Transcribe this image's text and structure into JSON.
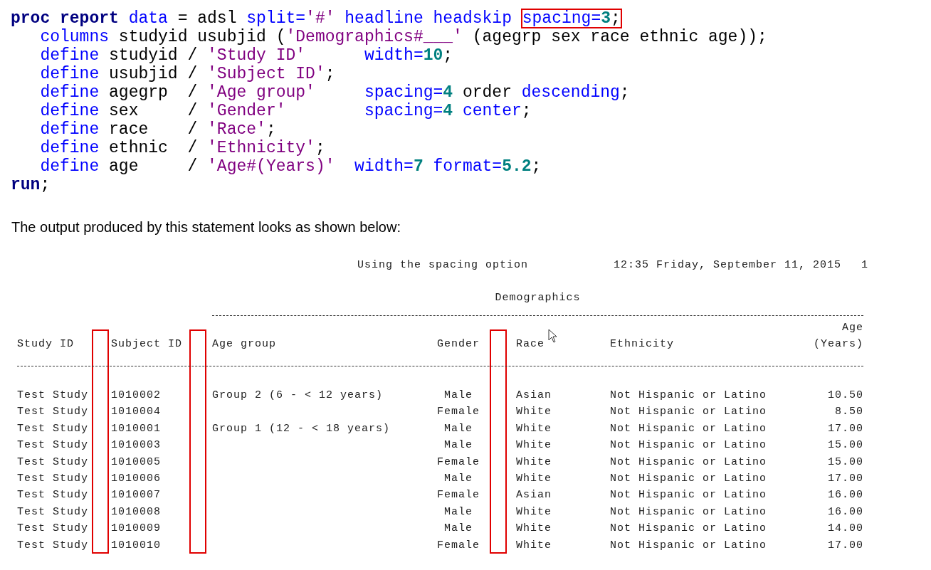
{
  "code": {
    "statements": [
      {
        "tokens": [
          {
            "text": "proc report",
            "kind": "keyword"
          },
          {
            "text": " data",
            "kind": "option"
          },
          {
            "text": " = adsl ",
            "kind": "plain"
          },
          {
            "text": "split=",
            "kind": "option"
          },
          {
            "text": "'#'",
            "kind": "string"
          },
          {
            "text": " headline headskip ",
            "kind": "option"
          },
          {
            "kind": "boxed",
            "tokens": [
              {
                "text": "spacing=",
                "kind": "option"
              },
              {
                "text": "3",
                "kind": "number"
              },
              {
                "text": ";",
                "kind": "plain"
              }
            ]
          }
        ],
        "children": [
          {
            "tokens": [
              {
                "text": "columns",
                "kind": "option"
              },
              {
                "text": " studyid usubjid (",
                "kind": "plain"
              },
              {
                "text": "'Demographics#___'",
                "kind": "string"
              },
              {
                "text": " (agegrp sex race ethnic age));",
                "kind": "plain"
              }
            ]
          },
          {
            "tokens": [
              {
                "text": "define",
                "kind": "option"
              },
              {
                "text": " studyid / ",
                "kind": "plain"
              },
              {
                "text": "'Study ID'",
                "kind": "string"
              },
              {
                "text": "      width=",
                "kind": "option"
              },
              {
                "text": "10",
                "kind": "number"
              },
              {
                "text": ";",
                "kind": "plain"
              }
            ]
          },
          {
            "tokens": [
              {
                "text": "define",
                "kind": "option"
              },
              {
                "text": " usubjid / ",
                "kind": "plain"
              },
              {
                "text": "'Subject ID'",
                "kind": "string"
              },
              {
                "text": ";",
                "kind": "plain"
              }
            ]
          },
          {
            "tokens": [
              {
                "text": "define",
                "kind": "option"
              },
              {
                "text": " agegrp  / ",
                "kind": "plain"
              },
              {
                "text": "'Age group'",
                "kind": "string"
              },
              {
                "text": "     spacing=",
                "kind": "option"
              },
              {
                "text": "4",
                "kind": "number"
              },
              {
                "text": " order ",
                "kind": "plain"
              },
              {
                "text": "descending",
                "kind": "option"
              },
              {
                "text": ";",
                "kind": "plain"
              }
            ]
          },
          {
            "tokens": [
              {
                "text": "define",
                "kind": "option"
              },
              {
                "text": " sex     / ",
                "kind": "plain"
              },
              {
                "text": "'Gender'",
                "kind": "string"
              },
              {
                "text": "        spacing=",
                "kind": "option"
              },
              {
                "text": "4",
                "kind": "number"
              },
              {
                "text": " center",
                "kind": "option"
              },
              {
                "text": ";",
                "kind": "plain"
              }
            ]
          },
          {
            "tokens": [
              {
                "text": "define",
                "kind": "option"
              },
              {
                "text": " race    / ",
                "kind": "plain"
              },
              {
                "text": "'Race'",
                "kind": "string"
              },
              {
                "text": ";",
                "kind": "plain"
              }
            ]
          },
          {
            "tokens": [
              {
                "text": "define",
                "kind": "option"
              },
              {
                "text": " ethnic  / ",
                "kind": "plain"
              },
              {
                "text": "'Ethnicity'",
                "kind": "string"
              },
              {
                "text": ";",
                "kind": "plain"
              }
            ]
          },
          {
            "tokens": [
              {
                "text": "define",
                "kind": "option"
              },
              {
                "text": " age     / ",
                "kind": "plain"
              },
              {
                "text": "'Age#(Years)'",
                "kind": "string"
              },
              {
                "text": "  width=",
                "kind": "option"
              },
              {
                "text": "7",
                "kind": "number"
              },
              {
                "text": " format=",
                "kind": "option"
              },
              {
                "text": "5.2",
                "kind": "number"
              },
              {
                "text": ";",
                "kind": "plain"
              }
            ]
          }
        ]
      },
      {
        "tokens": [
          {
            "text": "run",
            "kind": "keyword"
          },
          {
            "text": ";",
            "kind": "plain"
          }
        ]
      }
    ]
  },
  "paragraph": "The output produced by this statement looks as shown below:",
  "report": {
    "title": "Using the spacing option",
    "timestamp": "12:35 Friday, September 11, 2015",
    "page": "1",
    "spanning_header": "Demographics",
    "columns": [
      {
        "header": [
          "Study ID"
        ],
        "gap_highlighted": false
      },
      {
        "header": [
          "Subject ID"
        ],
        "gap_highlighted": true
      },
      {
        "header": [
          "Age group"
        ],
        "gap_highlighted": true
      },
      {
        "header": [
          "Gender"
        ],
        "gap_highlighted": false
      },
      {
        "header": [
          "Race"
        ],
        "gap_highlighted": true
      },
      {
        "header": [
          "Ethnicity"
        ],
        "gap_highlighted": false
      },
      {
        "header": [
          "Age",
          "(Years)"
        ],
        "gap_highlighted": false
      }
    ],
    "rows": [
      {
        "study_id": "Test Study",
        "subject_id": "1010002",
        "age_group": "Group 2 (6 - < 12 years)",
        "gender": "Male",
        "race": "Asian",
        "ethnicity": "Not Hispanic or Latino",
        "age": "10.50"
      },
      {
        "study_id": "Test Study",
        "subject_id": "1010004",
        "gender": "Female",
        "race": "White",
        "ethnicity": "Not Hispanic or Latino",
        "age": "8.50"
      },
      {
        "study_id": "Test Study",
        "subject_id": "1010001",
        "age_group": "Group 1 (12 - < 18 years)",
        "gender": "Male",
        "race": "White",
        "ethnicity": "Not Hispanic or Latino",
        "age": "17.00"
      },
      {
        "study_id": "Test Study",
        "subject_id": "1010003",
        "gender": "Male",
        "race": "White",
        "ethnicity": "Not Hispanic or Latino",
        "age": "15.00"
      },
      {
        "study_id": "Test Study",
        "subject_id": "1010005",
        "gender": "Female",
        "race": "White",
        "ethnicity": "Not Hispanic or Latino",
        "age": "15.00"
      },
      {
        "study_id": "Test Study",
        "subject_id": "1010006",
        "gender": "Male",
        "race": "White",
        "ethnicity": "Not Hispanic or Latino",
        "age": "17.00"
      },
      {
        "study_id": "Test Study",
        "subject_id": "1010007",
        "gender": "Female",
        "race": "Asian",
        "ethnicity": "Not Hispanic or Latino",
        "age": "16.00"
      },
      {
        "study_id": "Test Study",
        "subject_id": "1010008",
        "gender": "Male",
        "race": "White",
        "ethnicity": "Not Hispanic or Latino",
        "age": "16.00"
      },
      {
        "study_id": "Test Study",
        "subject_id": "1010009",
        "gender": "Male",
        "race": "White",
        "ethnicity": "Not Hispanic or Latino",
        "age": "14.00"
      },
      {
        "study_id": "Test Study",
        "subject_id": "1010010",
        "gender": "Female",
        "race": "White",
        "ethnicity": "Not Hispanic or Latino",
        "age": "17.00"
      }
    ]
  }
}
